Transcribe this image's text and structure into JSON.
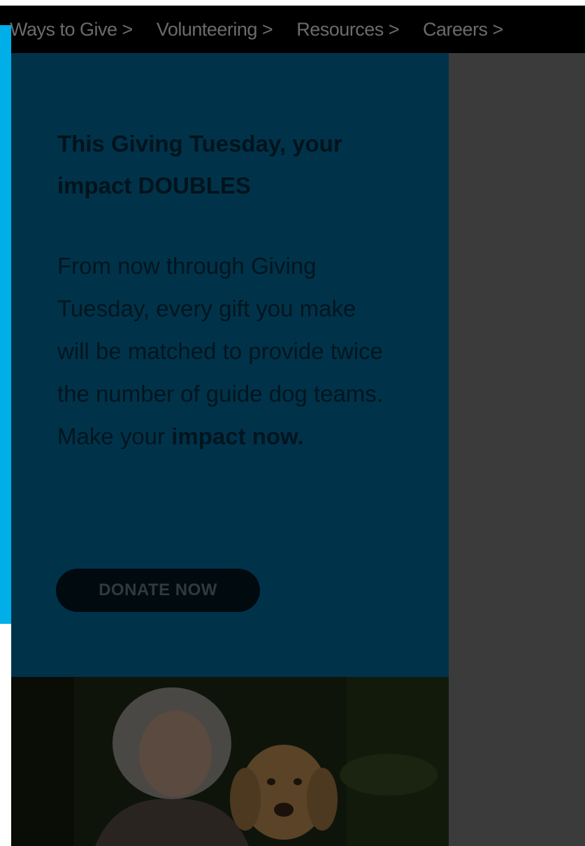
{
  "nav": {
    "items": [
      {
        "label": "Ways to Give >"
      },
      {
        "label": "Volunteering >"
      },
      {
        "label": "Resources >"
      },
      {
        "label": "Careers >"
      }
    ]
  },
  "promo": {
    "heading": "This Giving Tuesday, your impact DOUBLES",
    "body_text": "From now through Giving Tuesday, every gift you make will be matched to provide twice the number of guide dog teams. Make your",
    "body_strong": "impact now.",
    "donate_label": "DONATE NOW"
  },
  "colors": {
    "accent_cyan": "#00aee8",
    "promo_bg": "#00334a",
    "nav_bg": "#000000",
    "overlay_gray": "#3b3b3b"
  }
}
